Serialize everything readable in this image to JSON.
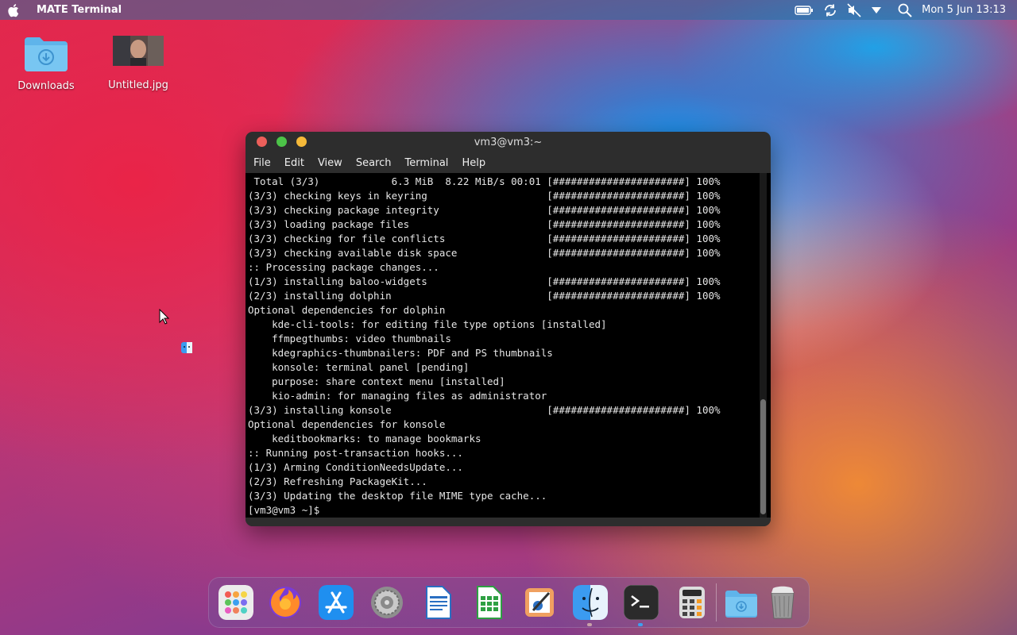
{
  "menubar": {
    "app_title": "MATE Terminal",
    "clock": "Mon 5 Jun 13:13",
    "icons": [
      "apple-icon",
      "battery-icon",
      "sync-icon",
      "volume-muted-icon",
      "dropdown-icon",
      "search-icon"
    ]
  },
  "desktop": {
    "icons": [
      {
        "label": "Downloads"
      },
      {
        "label": "Untitled.jpg"
      }
    ]
  },
  "terminal": {
    "title": "vm3@vm3:~",
    "menu": [
      "File",
      "Edit",
      "View",
      "Search",
      "Terminal",
      "Help"
    ],
    "lines": [
      " Total (3/3)            6.3 MiB  8.22 MiB/s 00:01 [######################] 100%",
      "(3/3) checking keys in keyring                    [######################] 100%",
      "(3/3) checking package integrity                  [######################] 100%",
      "(3/3) loading package files                       [######################] 100%",
      "(3/3) checking for file conflicts                 [######################] 100%",
      "(3/3) checking available disk space               [######################] 100%",
      ":: Processing package changes...",
      "(1/3) installing baloo-widgets                    [######################] 100%",
      "(2/3) installing dolphin                          [######################] 100%",
      "Optional dependencies for dolphin",
      "    kde-cli-tools: for editing file type options [installed]",
      "    ffmpegthumbs: video thumbnails",
      "    kdegraphics-thumbnailers: PDF and PS thumbnails",
      "    konsole: terminal panel [pending]",
      "    purpose: share context menu [installed]",
      "    kio-admin: for managing files as administrator",
      "(3/3) installing konsole                          [######################] 100%",
      "Optional dependencies for konsole",
      "    keditbookmarks: to manage bookmarks",
      ":: Running post-transaction hooks...",
      "(1/3) Arming ConditionNeedsUpdate...",
      "(2/3) Refreshing PackageKit...",
      "(3/3) Updating the desktop file MIME type cache...",
      "[vm3@vm3 ~]$ "
    ]
  },
  "dock": {
    "items": [
      {
        "name": "launchpad-icon",
        "color": "#e8e8e8"
      },
      {
        "name": "firefox-icon",
        "color": "#ff7a2a"
      },
      {
        "name": "app-store-icon",
        "color": "#1f8ff0"
      },
      {
        "name": "system-settings-icon",
        "color": "#9a9a9a"
      },
      {
        "name": "writer-icon",
        "color": "#2a6fc2"
      },
      {
        "name": "calc-icon",
        "color": "#2ea043"
      },
      {
        "name": "draw-icon",
        "color": "#f0a060"
      },
      {
        "name": "finder-icon",
        "color": "#3b9bf0"
      },
      {
        "name": "terminal-icon",
        "color": "#2b2b2b"
      },
      {
        "name": "calculator-icon",
        "color": "#d8d8d8"
      },
      {
        "name": "downloads-folder-icon",
        "color": "#5fb4ea"
      },
      {
        "name": "trash-icon",
        "color": "#8a8a8a"
      }
    ]
  }
}
